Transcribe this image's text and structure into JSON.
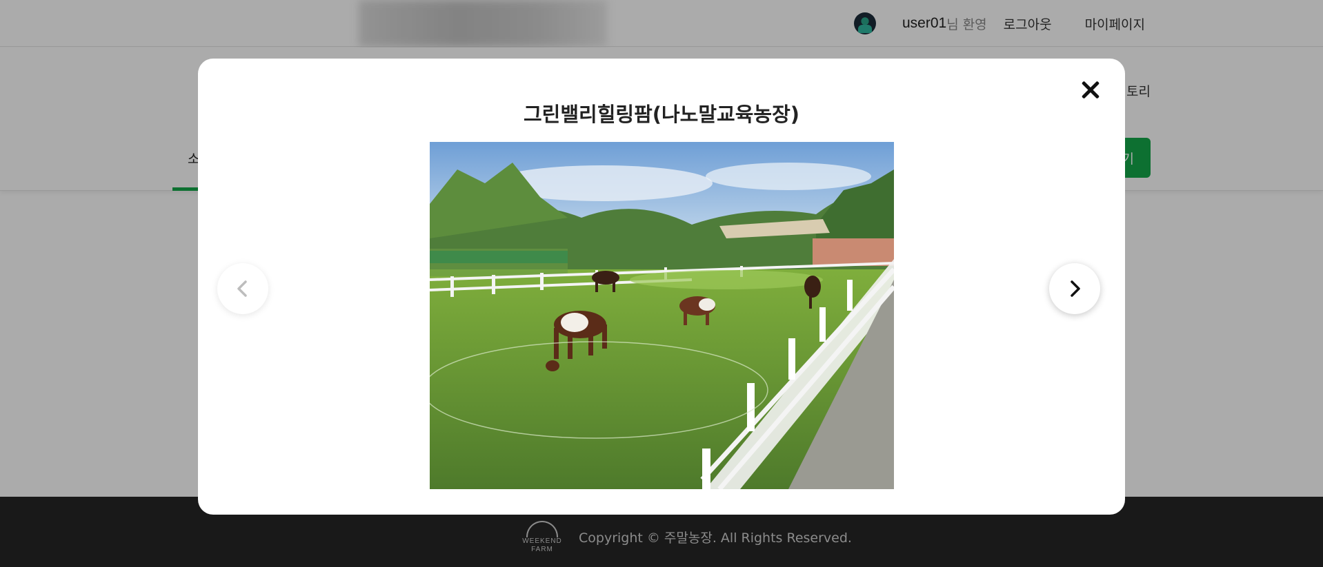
{
  "header": {
    "user_name": "user01",
    "welcome_suffix": "님 환영",
    "logout_label": "로그아웃",
    "mypage_label": "마이페이지"
  },
  "subnav": {
    "first_tab_partial": "소",
    "story_partial": "토리",
    "action_partial": "기"
  },
  "modal": {
    "title": "그린밸리힐링팜(나노말교육농장)",
    "close_icon": "close-icon",
    "prev_icon": "chevron-left-icon",
    "next_icon": "chevron-right-icon"
  },
  "footer": {
    "logo_text_top": "WEEKEND",
    "logo_text_bottom": "FARM",
    "copyright": "Copyright © 주말농장. All Rights Reserved."
  },
  "colors": {
    "accent_green": "#14a84a",
    "footer_bg": "#262626"
  }
}
